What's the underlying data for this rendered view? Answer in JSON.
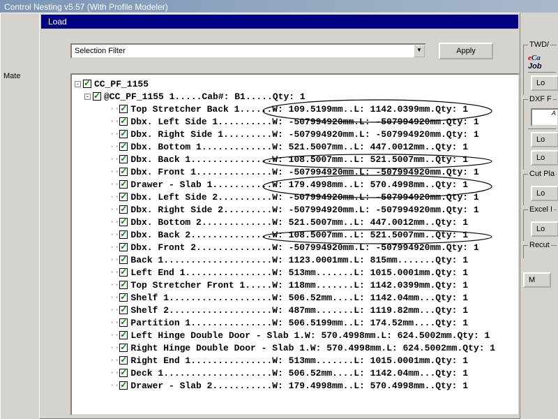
{
  "titlebar": "Control Nesting v5.57 (With Profile Modeler)",
  "left_label": "Mate",
  "tab": "Load",
  "filter": {
    "text": "Selection Filter",
    "apply": "Apply"
  },
  "tree": {
    "root": "CC_PF_1155",
    "sub": "@CC_PF_1155 1.....Cab#: B1.....Qty: 1",
    "items": [
      "Top Stretcher Back 1......W: 109.5199mm..L: 1142.0399mm.Qty: 1",
      "Dbx. Left Side 1..........W: -507994920mm.L: -507994920mm.Qty: 1",
      "Dbx. Right Side 1.........W: -507994920mm.L: -507994920mm.Qty: 1",
      "Dbx. Bottom 1.............W: 521.5007mm..L: 447.0012mm..Qty: 1",
      "Dbx. Back 1...............W: 108.5007mm..L: 521.5007mm..Qty: 1",
      "Dbx. Front 1..............W: -507994920mm.L: -507994920mm.Qty: 1",
      "Drawer - Slab 1...........W: 179.4998mm..L: 570.4998mm..Qty: 1",
      "Dbx. Left Side 2..........W: -507994920mm.L: -507994920mm.Qty: 1",
      "Dbx. Right Side 2.........W: -507994920mm.L: -507994920mm.Qty: 1",
      "Dbx. Bottom 2.............W: 521.5007mm..L: 447.0012mm..Qty: 1",
      "Dbx. Back 2...............W: 108.5007mm..L: 521.5007mm..Qty: 1",
      "Dbx. Front 2..............W: -507994920mm.L: -507994920mm.Qty: 1",
      "Back 1....................W: 1123.0001mm.L: 815mm.......Qty: 1",
      "Left End 1................W: 513mm.......L: 1015.0001mm.Qty: 1",
      "Top Stretcher Front 1.....W: 118mm.......L: 1142.0399mm.Qty: 1",
      "Shelf 1...................W: 506.52mm....L: 1142.04mm...Qty: 1",
      "Shelf 2...................W: 487mm.......L: 1119.82mm...Qty: 1",
      "Partition 1...............W: 506.5199mm..L: 174.52mm....Qty: 1",
      "Left Hinge Double Door - Slab 1.W: 570.4998mm.L: 624.5002mm.Qty: 1",
      "Right Hinge Double Door - Slab 1.W: 570.4998mm.L: 624.5002mm.Qty: 1",
      "Right End 1...............W: 513mm.......L: 1015.0001mm.Qty: 1",
      "Deck 1....................W: 506.52mm....L: 1142.04mm...Qty: 1",
      "Drawer - Slab 2...........W: 179.4998mm..L: 570.4998mm..Qty: 1"
    ]
  },
  "right": {
    "twd": "TWD/",
    "ecab_e": "e",
    "ecab_rest": "Ca",
    "job": "Job",
    "lo": "Lo",
    "dxf": "DXF F",
    "cut": "Cut Pla",
    "excel": "Excel I",
    "recut": "Recut",
    "m": "M"
  }
}
